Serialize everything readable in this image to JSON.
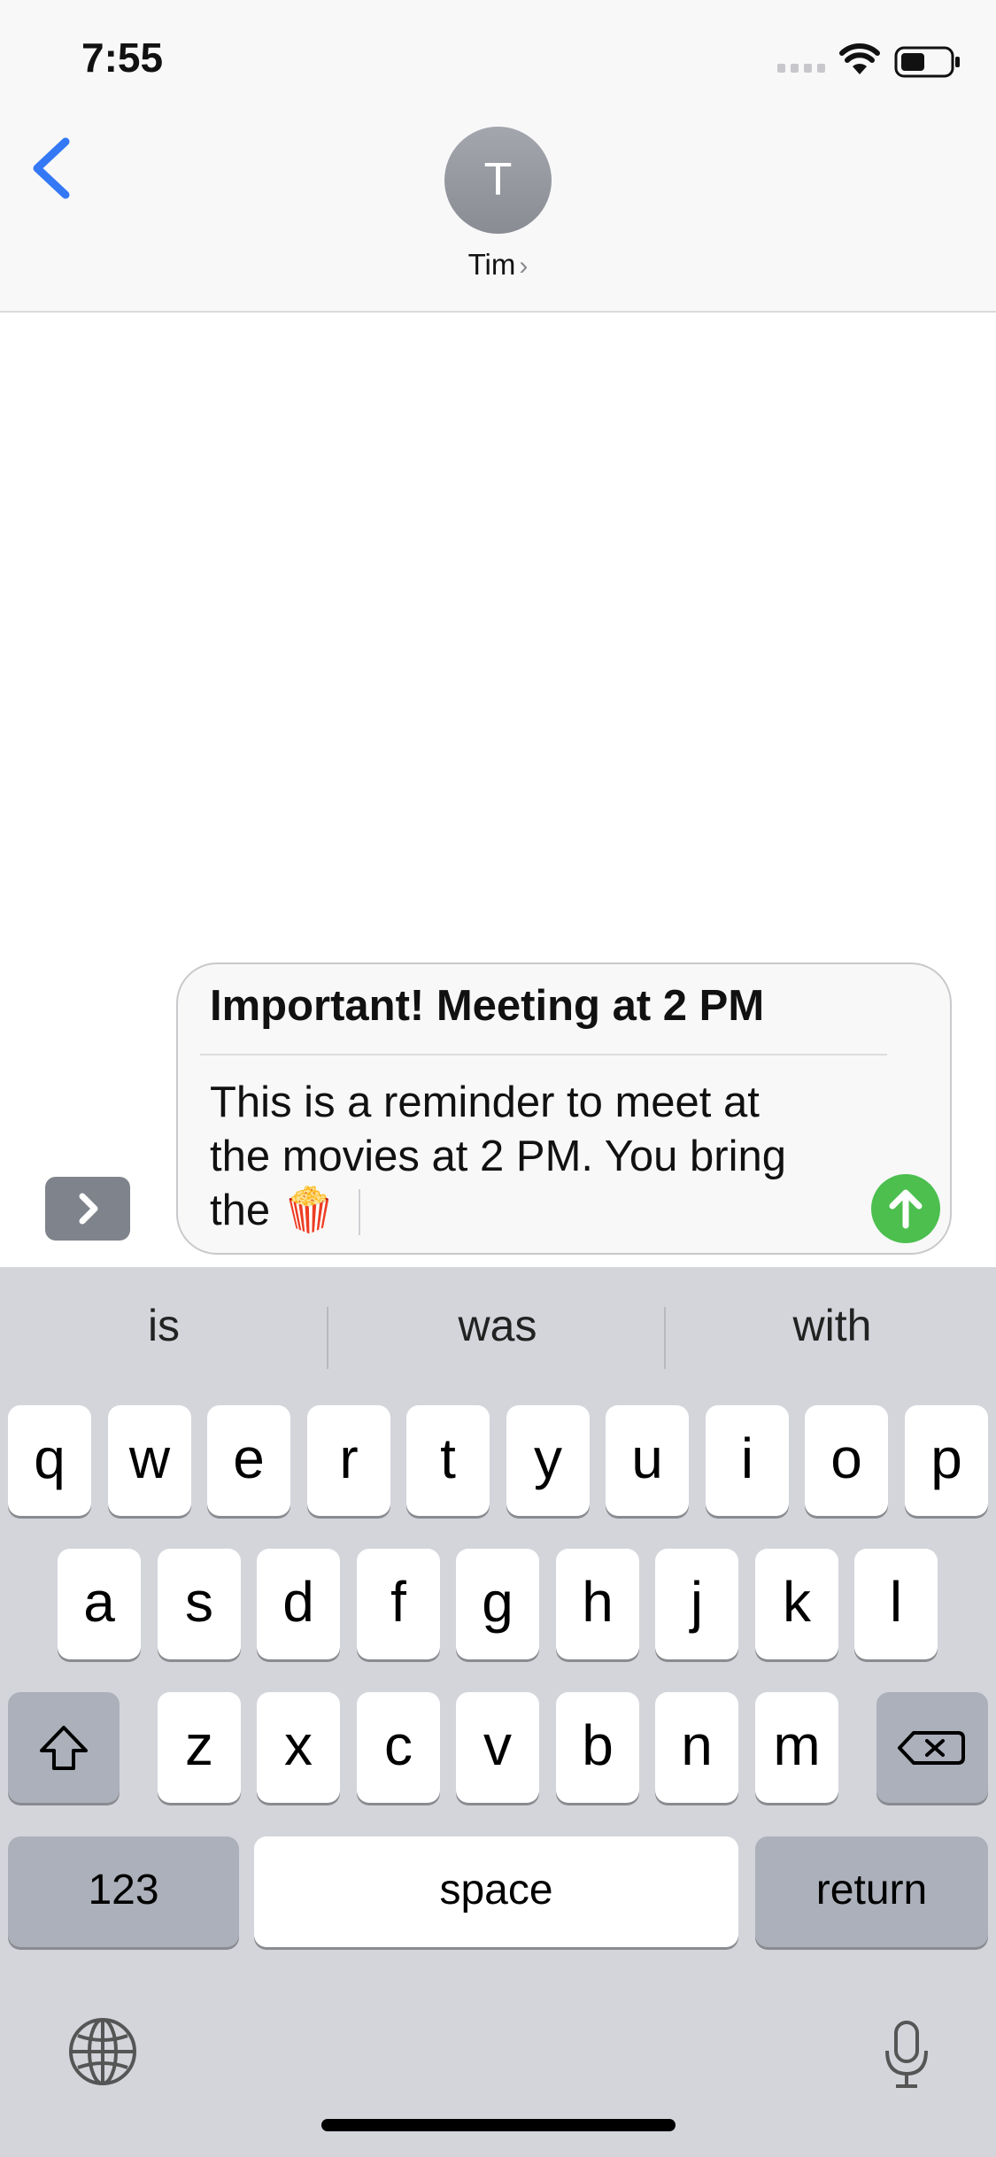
{
  "status_bar": {
    "time": "7:55"
  },
  "nav": {
    "contact_initial": "T",
    "contact_name": "Tim",
    "contact_chevron": "›"
  },
  "compose": {
    "subject": "Important! Meeting at 2 PM",
    "body_lines": [
      "This is a reminder to meet at",
      "the movies at 2 PM. You bring",
      "the 🍿"
    ]
  },
  "keyboard": {
    "suggestions": [
      "is",
      "was",
      "with"
    ],
    "row1": [
      "q",
      "w",
      "e",
      "r",
      "t",
      "y",
      "u",
      "i",
      "o",
      "p"
    ],
    "row2": [
      "a",
      "s",
      "d",
      "f",
      "g",
      "h",
      "j",
      "k",
      "l"
    ],
    "row3": [
      "z",
      "x",
      "c",
      "v",
      "b",
      "n",
      "m"
    ],
    "numbers_label": "123",
    "space_label": "space",
    "return_label": "return"
  },
  "colors": {
    "accent": "#3478f6",
    "send": "#4cbf4e"
  }
}
